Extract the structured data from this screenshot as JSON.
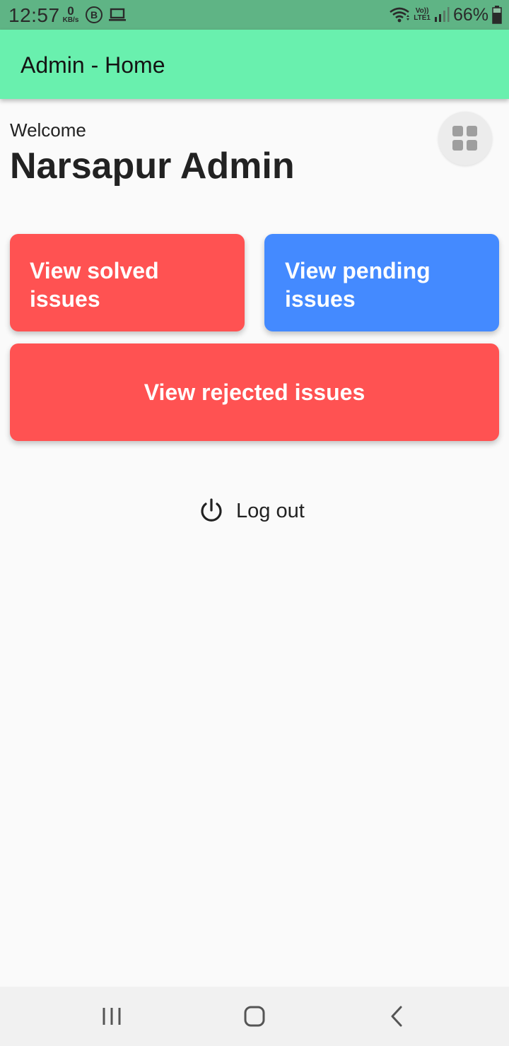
{
  "status_bar": {
    "time": "12:57",
    "net_speed_value": "0",
    "net_speed_unit": "KB/s",
    "b_badge": "B",
    "volte_top": "Vo))",
    "volte_bottom": "LTE1",
    "battery_percent": "66%"
  },
  "app_bar": {
    "title": "Admin - Home"
  },
  "header": {
    "welcome": "Welcome",
    "admin_name": "Narsapur Admin"
  },
  "actions": {
    "solved_label": "View solved issues",
    "pending_label": "View pending issues",
    "rejected_label": "View rejected issues"
  },
  "logout": {
    "label": "Log out"
  },
  "colors": {
    "status_bar": "#5fb485",
    "app_bar": "#69f0ae",
    "solved": "#ff5252",
    "pending": "#448aff",
    "rejected": "#ff5252",
    "background": "#fafafa"
  },
  "icons": {
    "grid": "grid-view-icon",
    "logout": "power-icon",
    "nav_recents": "recents-icon",
    "nav_home": "home-icon",
    "nav_back": "back-icon"
  }
}
